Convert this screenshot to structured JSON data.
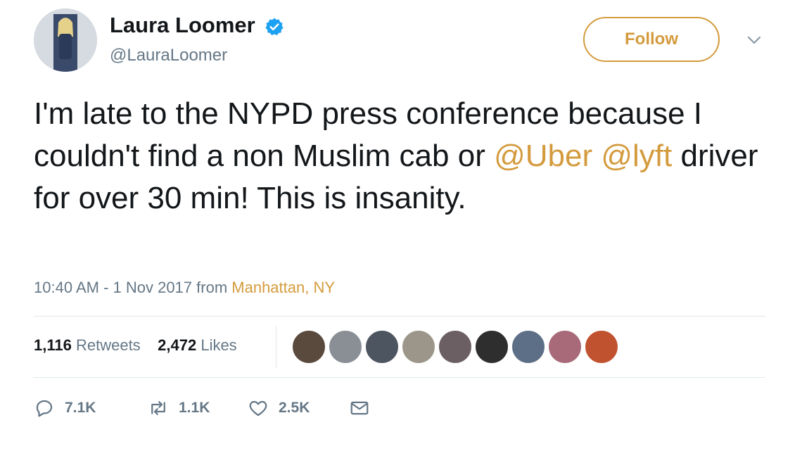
{
  "tweet": {
    "author": {
      "display_name": "Laura Loomer",
      "handle": "@LauraLoomer",
      "verified": true,
      "avatar": "avatar-icon"
    },
    "follow_label": "Follow",
    "menu_icon": "chevron-down-icon",
    "text_parts": [
      {
        "text": "I'm late to the NYPD press conference because I couldn't find a non Muslim cab or ",
        "kind": "plain"
      },
      {
        "text": "@Uber",
        "kind": "mention"
      },
      {
        "text": " ",
        "kind": "plain"
      },
      {
        "text": "@lyft",
        "kind": "mention"
      },
      {
        "text": " driver for over 30 min! This is insanity.",
        "kind": "plain"
      }
    ],
    "timestamp": "10:40 AM - 1 Nov 2017",
    "from_label": " from ",
    "location": "Manhattan, NY",
    "stats": {
      "retweets_count": "1,116",
      "retweets_label": "Retweets",
      "likes_count": "2,472",
      "likes_label": "Likes"
    },
    "actions": {
      "reply_count": "7.1K",
      "retweet_count": "1.1K",
      "like_count": "2.5K"
    }
  },
  "colors": {
    "accent": "#d49b3e",
    "text": "#14171a",
    "muted": "#657786",
    "verified": "#1da1f2",
    "divider": "#e1e8ed"
  }
}
